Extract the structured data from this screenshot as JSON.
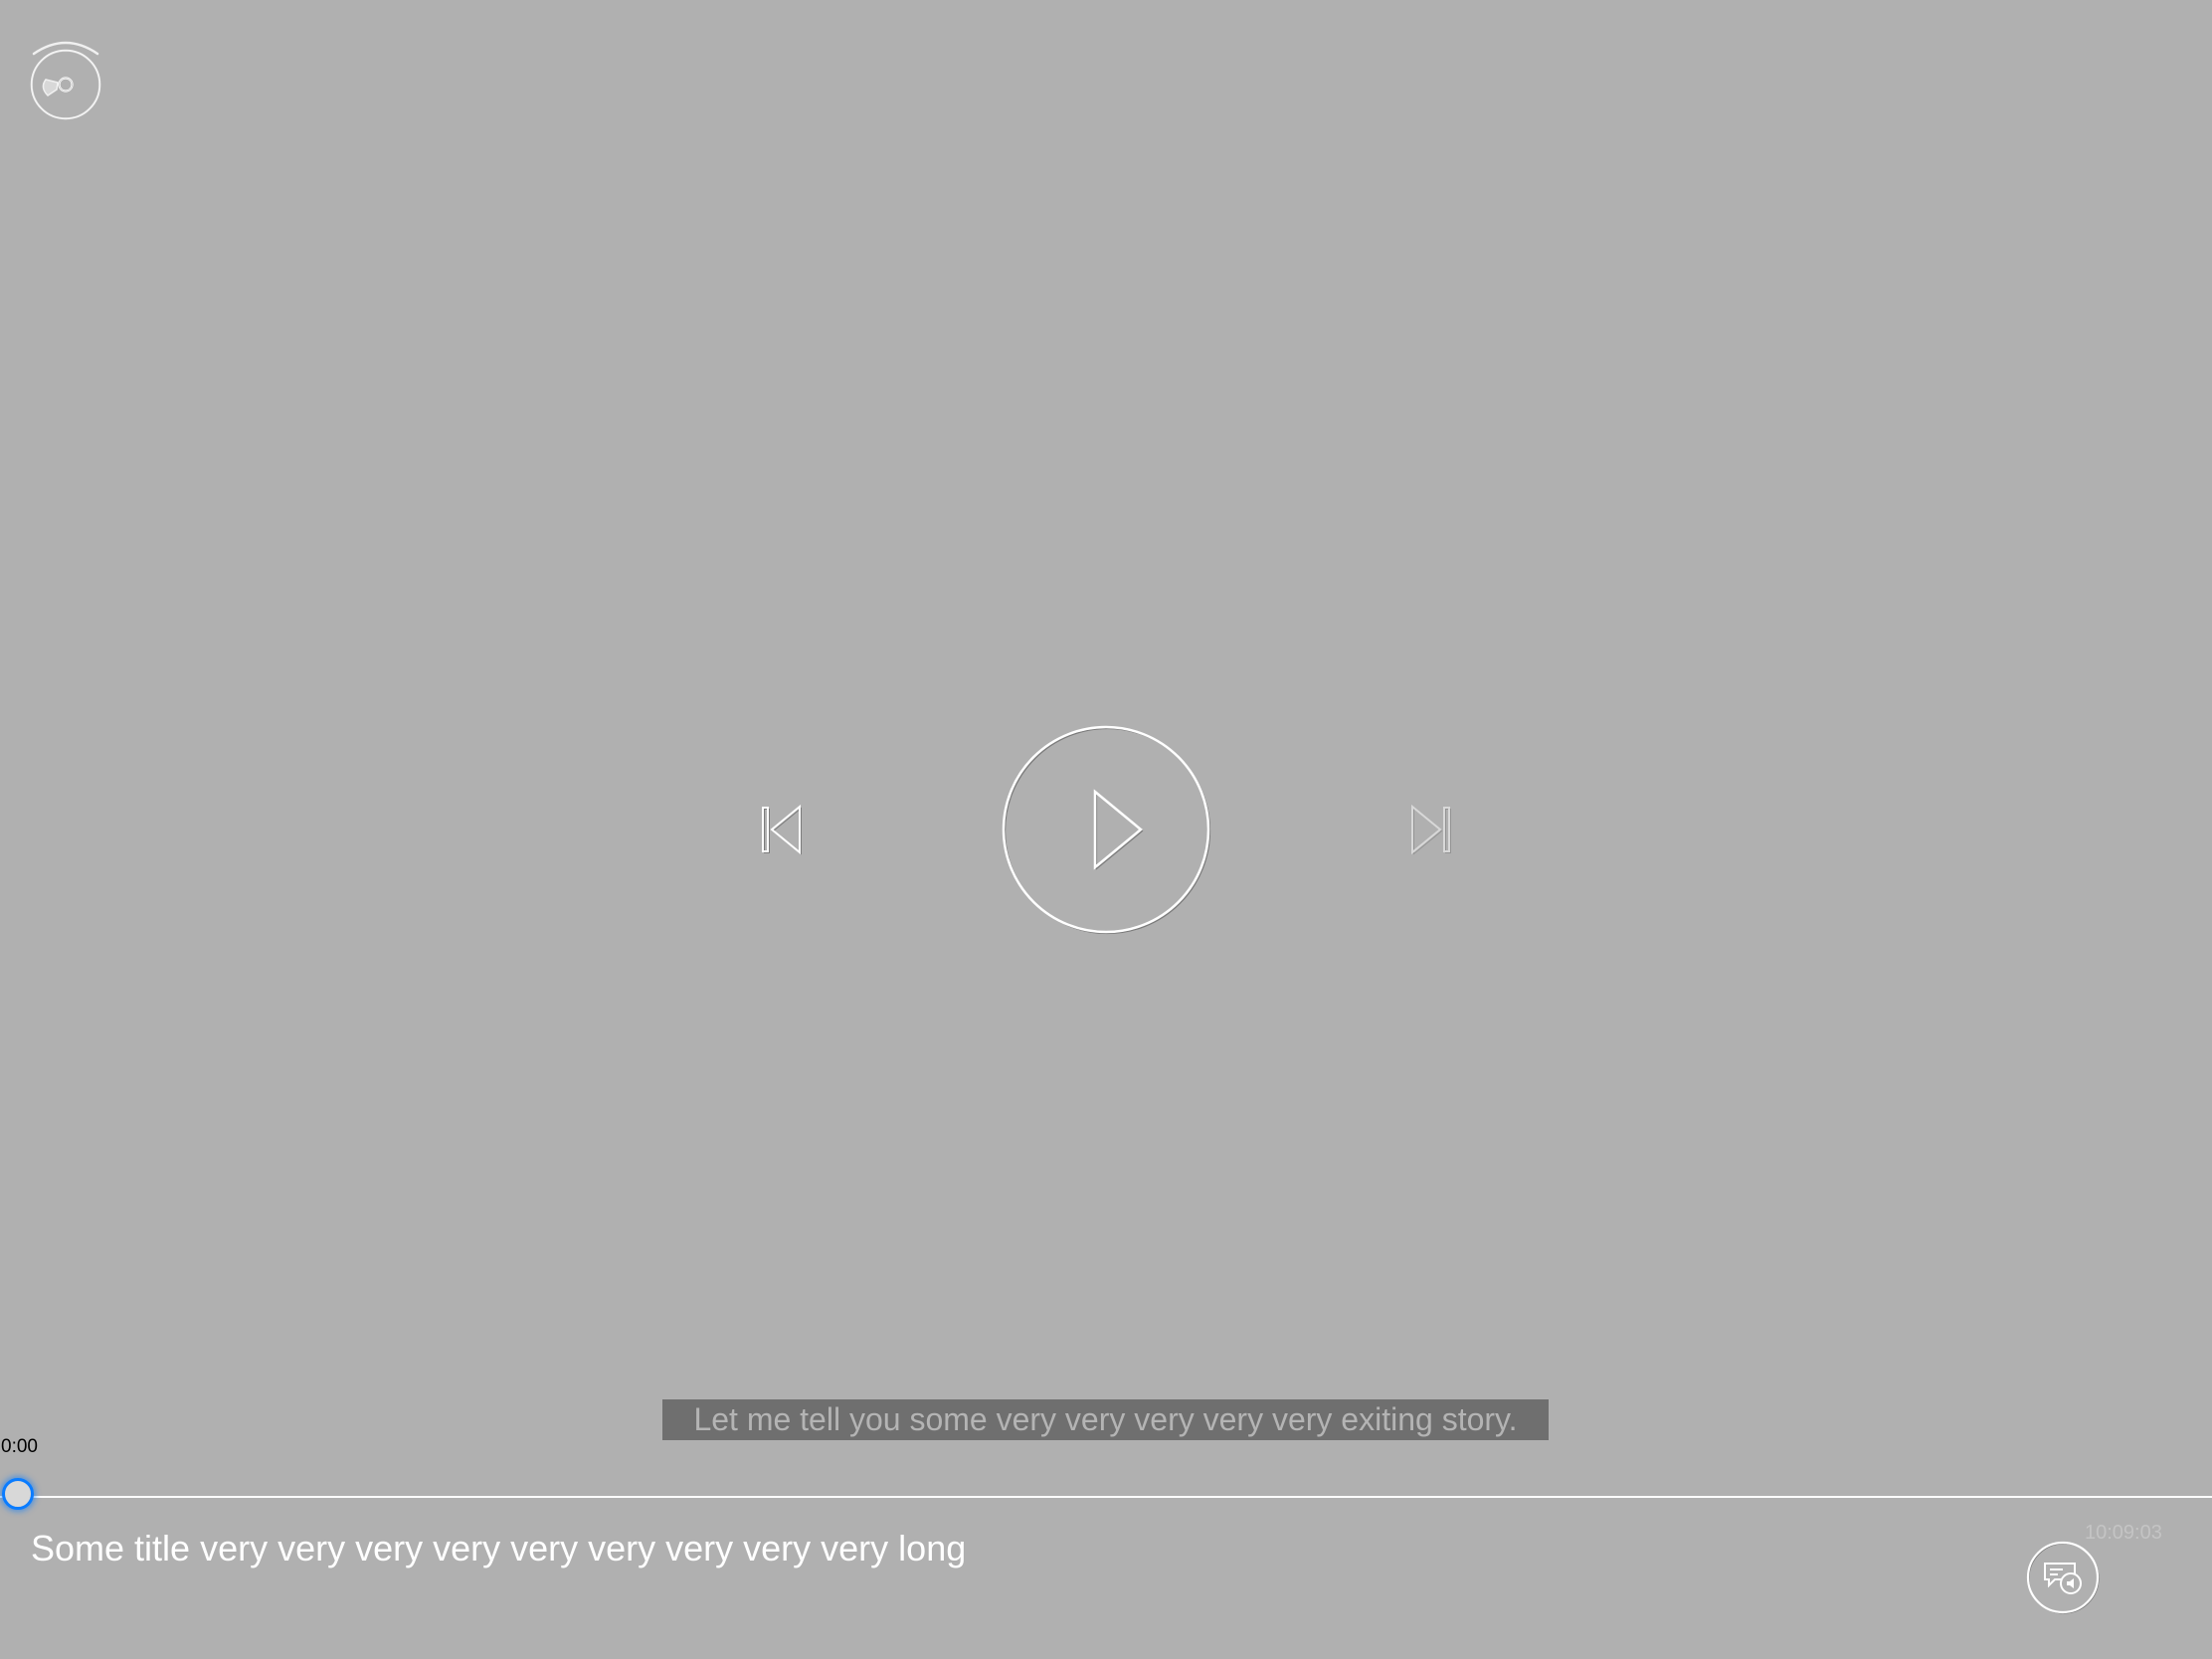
{
  "player": {
    "elapsed_time": "0:00",
    "total_time": "10:09:03",
    "progress": 0,
    "title": "Some title very very very very very very very very very long",
    "subtitle_text": "Let me tell you some very very very very very exiting story."
  },
  "colors": {
    "background": "#b0b0b0",
    "accent": "#0a7cff",
    "subtitle_background": "#6f6f6f",
    "subtitle_text": "#b4b4b4",
    "title_text": "#ffffff"
  },
  "icons": {
    "top_left": "disc-airplay-icon",
    "previous": "skip-previous-icon",
    "play": "play-icon",
    "next": "skip-next-icon",
    "subtitles": "subtitles-audio-icon"
  }
}
